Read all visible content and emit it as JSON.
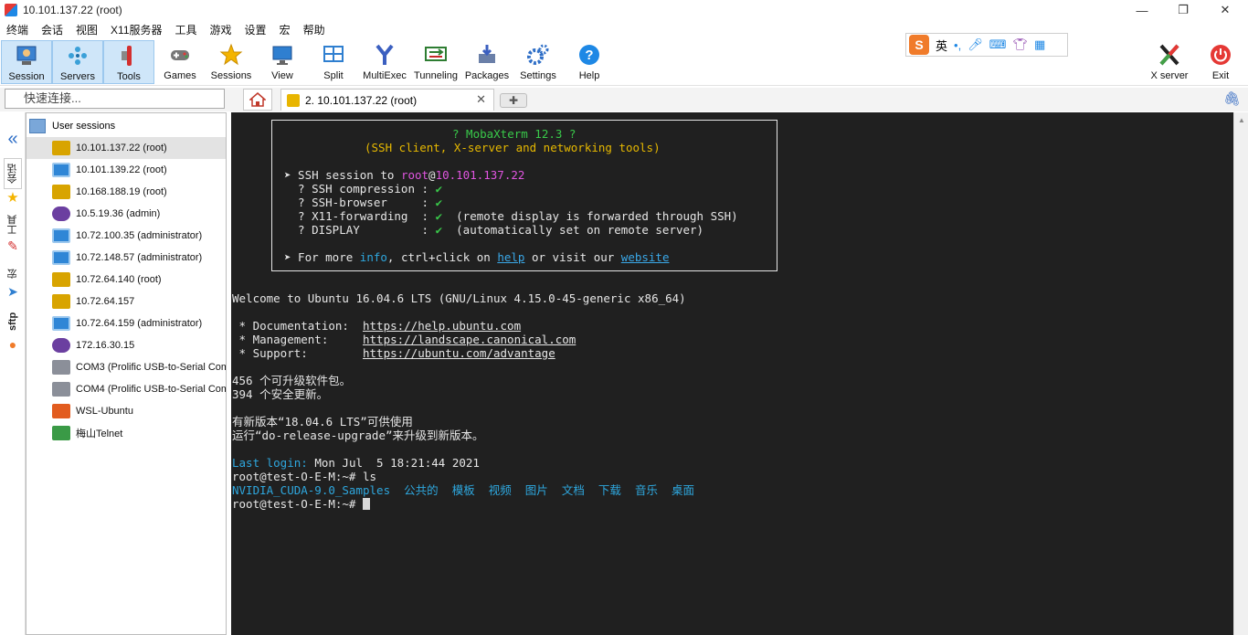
{
  "window": {
    "title": "10.101.137.22 (root)"
  },
  "menu": [
    "终端",
    "会话",
    "视图",
    "X11服务器",
    "工具",
    "游戏",
    "设置",
    "宏",
    "帮助"
  ],
  "toolbar": {
    "session": "Session",
    "servers": "Servers",
    "tools": "Tools",
    "games": "Games",
    "sessions": "Sessions",
    "view": "View",
    "split": "Split",
    "multiexec": "MultiExec",
    "tunneling": "Tunneling",
    "packages": "Packages",
    "settings": "Settings",
    "help": "Help",
    "xserver": "X server",
    "exit": "Exit"
  },
  "ime": {
    "lang": "英",
    "punct": "•,"
  },
  "quick": {
    "placeholder": "快速连接..."
  },
  "tabs": {
    "active": "2. 10.101.137.22 (root)"
  },
  "sidebar_tabs": {
    "sessions": "会话",
    "tools": "工具",
    "macros": "宏",
    "sftp": "sftp"
  },
  "sessions": {
    "header": "User sessions",
    "items": [
      {
        "label": "10.101.137.22 (root)",
        "type": "ssh",
        "selected": true
      },
      {
        "label": "10.101.139.22 (root)",
        "type": "rdp"
      },
      {
        "label": "10.168.188.19 (root)",
        "type": "ssh"
      },
      {
        "label": "10.5.19.36 (admin)",
        "type": "vnc"
      },
      {
        "label": "10.72.100.35 (administrator)",
        "type": "rdp"
      },
      {
        "label": "10.72.148.57 (administrator)",
        "type": "rdp"
      },
      {
        "label": "10.72.64.140 (root)",
        "type": "ssh"
      },
      {
        "label": "10.72.64.157",
        "type": "ssh"
      },
      {
        "label": "10.72.64.159 (administrator)",
        "type": "rdp"
      },
      {
        "label": "172.16.30.15",
        "type": "vnc"
      },
      {
        "label": "COM3  (Prolific USB-to-Serial Comm",
        "type": "ser"
      },
      {
        "label": "COM4  (Prolific USB-to-Serial Comm",
        "type": "ser"
      },
      {
        "label": "WSL-Ubuntu",
        "type": "wsl"
      },
      {
        "label": "梅山Telnet",
        "type": "tel"
      }
    ]
  },
  "terminal": {
    "banner_title": "? MobaXterm 12.3 ?",
    "banner_sub": "(SSH client, X-server and networking tools)",
    "ssh_prefix": "➤ SSH session to ",
    "user": "root",
    "at": "@",
    "host": "10.101.137.22",
    "opts": [
      {
        "k": "  ? SSH compression : ",
        "v": "✔",
        "note": ""
      },
      {
        "k": "  ? SSH-browser     : ",
        "v": "✔",
        "note": ""
      },
      {
        "k": "  ? X11-forwarding  : ",
        "v": "✔",
        "note": "  (remote display is forwarded through SSH)"
      },
      {
        "k": "  ? DISPLAY         : ",
        "v": "✔",
        "note": "  (automatically set on remote server)"
      }
    ],
    "more_prefix": "➤ For more ",
    "more_info": "info",
    "more_mid": ", ctrl+click on ",
    "more_help": "help",
    "more_or": " or visit our ",
    "more_web": "website",
    "welcome": "Welcome to Ubuntu 16.04.6 LTS (GNU/Linux 4.15.0-45-generic x86_64)",
    "doc_label": " * Documentation:  ",
    "doc_url": "https://help.ubuntu.com",
    "mgmt_label": " * Management:     ",
    "mgmt_url": "https://landscape.canonical.com",
    "sup_label": " * Support:        ",
    "sup_url": "https://ubuntu.com/advantage",
    "upd1": "456 个可升级软件包。",
    "upd2": "394 个安全更新。",
    "rel1": "有新版本“18.04.6 LTS”可供使用",
    "rel2": "运行“do-release-upgrade”来升级到新版本。",
    "last_label": "Last login:",
    "last_value": " Mon Jul  5 18:21:44 2021",
    "prompt1": "root@test-O-E-M:~# ls",
    "ls": "NVIDIA_CUDA-9.0_Samples  公共的  模板  视频  图片  文档  下载  音乐  桌面",
    "prompt2": "root@test-O-E-M:~# "
  }
}
